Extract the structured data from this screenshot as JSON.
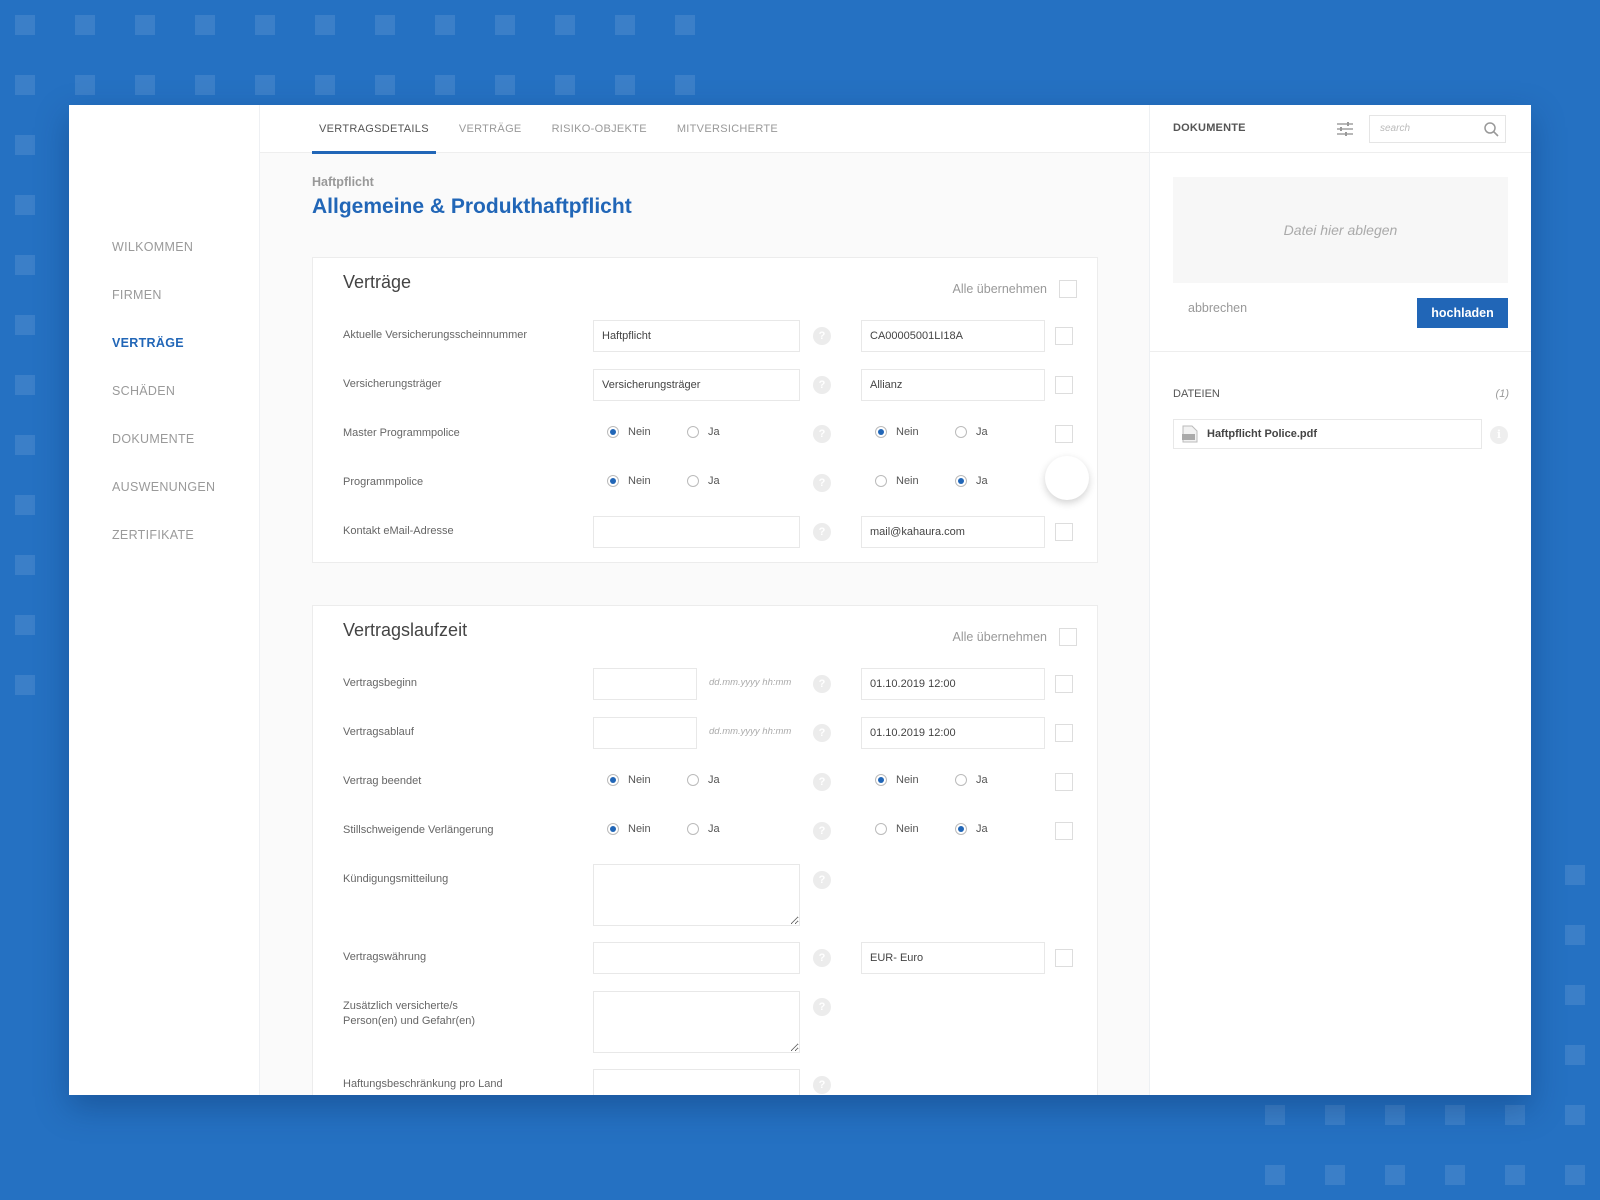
{
  "sidebar": {
    "items": [
      {
        "label": "WILKOMMEN"
      },
      {
        "label": "FIRMEN"
      },
      {
        "label": "VERTRÄGE",
        "active": true
      },
      {
        "label": "SCHÄDEN"
      },
      {
        "label": "DOKUMENTE"
      },
      {
        "label": "AUSWENUNGEN"
      },
      {
        "label": "ZERTIFIKATE"
      }
    ]
  },
  "tabs": [
    {
      "label": "VERTRAGSDETAILS",
      "active": true
    },
    {
      "label": "VERTRÄGE"
    },
    {
      "label": "RISIKO-OBJEKTE"
    },
    {
      "label": "MITVERSICHERTE"
    }
  ],
  "page": {
    "subtitle": "Haftpflicht",
    "title": "Allgemeine & Produkthaftpflicht"
  },
  "common": {
    "take_all": "Alle übernehmen",
    "help_glyph": "?",
    "radio_no": "Nein",
    "radio_yes": "Ja",
    "date_format": "dd.mm.yyyy hh:mm"
  },
  "section_vertraege": {
    "title": "Verträge",
    "rows": [
      {
        "label": "Aktuelle Versicherungsscheinnummer",
        "left_value": "Haftpflicht",
        "right_value": "CA00005001LI18A"
      },
      {
        "label": "Versicherungsträger",
        "left_value": "Versicherungsträger",
        "right_value": "Allianz"
      },
      {
        "label": "Master Programmpolice",
        "left_choice": "Nein",
        "right_choice": "Nein"
      },
      {
        "label": "Programmpolice",
        "left_choice": "Nein",
        "right_choice": "Ja"
      },
      {
        "label": "Kontakt eMail-Adresse",
        "left_value": "",
        "right_value": "mail@kahaura.com"
      }
    ]
  },
  "section_laufzeit": {
    "title": "Vertragslaufzeit",
    "rows": [
      {
        "label": "Vertragsbeginn",
        "left_value": "",
        "right_value": "01.10.2019  12:00"
      },
      {
        "label": "Vertragsablauf",
        "left_value": "",
        "right_value": "01.10.2019  12:00"
      },
      {
        "label": "Vertrag beendet",
        "left_choice": "Nein",
        "right_choice": "Nein"
      },
      {
        "label": "Stillschweigende Verlängerung",
        "left_choice": "Nein",
        "right_choice": "Ja"
      },
      {
        "label": "Kündigungsmitteilung",
        "left_value": ""
      },
      {
        "label": "Vertragswährung",
        "left_value": "",
        "right_value": "EUR- Euro"
      },
      {
        "label": "Zusätzlich versicherte/s Person(en) und Gefahr(en)",
        "left_value": ""
      },
      {
        "label": "Haftungsbeschränkung pro Land",
        "left_value": ""
      }
    ]
  },
  "documents": {
    "title": "DOKUMENTE",
    "search_placeholder": "search",
    "dropzone_text": "Datei hier ablegen",
    "cancel_label": "abbrechen",
    "upload_label": "hochladen",
    "files_label": "DATEIEN",
    "files_count": "(1)",
    "files": [
      {
        "name": "Haftpflicht Police.pdf",
        "type": "pdf-file-icon"
      }
    ],
    "info_glyph": "i"
  },
  "colors": {
    "accent": "#2166b7",
    "background": "#2571c2"
  }
}
